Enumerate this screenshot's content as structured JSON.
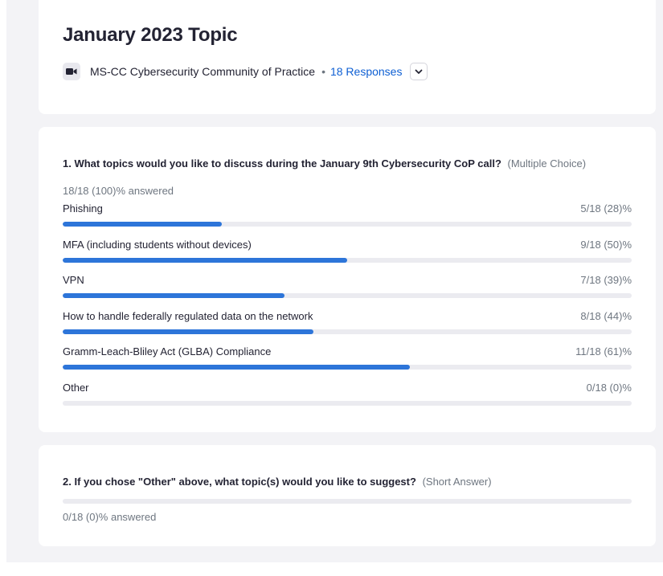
{
  "header": {
    "title": "January 2023 Topic",
    "meeting_icon": "video-camera-icon",
    "meeting_name": "MS-CC Cybersecurity Community of Practice",
    "separator": "•",
    "responses_label": "18 Responses",
    "expand_icon": "chevron-down-icon"
  },
  "question1": {
    "title": "1. What topics would you like to discuss during the January 9th Cybersecurity CoP call?",
    "type": "(Multiple Choice)",
    "answered": "18/18 (100)% answered",
    "options": [
      {
        "label": "Phishing",
        "count": "5/18 (28)%",
        "fraction": 0.28
      },
      {
        "label": "MFA (including students without devices)",
        "count": "9/18 (50)%",
        "fraction": 0.5
      },
      {
        "label": "VPN",
        "count": "7/18 (39)%",
        "fraction": 0.39
      },
      {
        "label": "How to handle federally regulated data on the network",
        "count": "8/18 (44)%",
        "fraction": 0.44
      },
      {
        "label": "Gramm-Leach-Bliley Act (GLBA) Compliance",
        "count": "11/18 (61)%",
        "fraction": 0.61
      },
      {
        "label": "Other",
        "count": "0/18 (0)%",
        "fraction": 0
      }
    ]
  },
  "question2": {
    "title": "2. If you chose \"Other\" above, what topic(s) would you like to suggest?",
    "type": "(Short Answer)",
    "answered": "0/18 (0)% answered",
    "fraction": 0
  },
  "colors": {
    "accent": "#2d75d9",
    "link": "#0e5fd3",
    "track": "#ebebf0",
    "background": "#f3f3f6"
  }
}
